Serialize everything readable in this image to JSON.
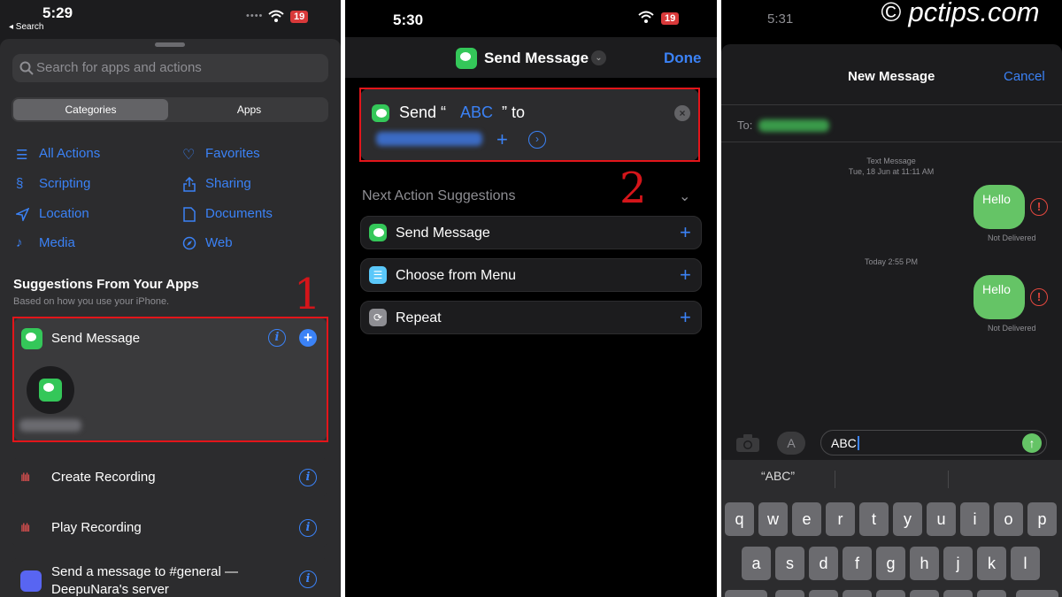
{
  "watermark": "© pctips.com",
  "panel1": {
    "status": {
      "time": "5:29",
      "back": "◂ Search",
      "battery": "19"
    },
    "search_placeholder": "Search for apps and actions",
    "segments": [
      "Categories",
      "Apps"
    ],
    "categories": [
      {
        "label": "All Actions",
        "icon": "list-icon"
      },
      {
        "label": "Favorites",
        "icon": "heart-icon"
      },
      {
        "label": "Scripting",
        "icon": "scripting-icon"
      },
      {
        "label": "Sharing",
        "icon": "share-icon"
      },
      {
        "label": "Location",
        "icon": "location-arrow-icon"
      },
      {
        "label": "Documents",
        "icon": "document-icon"
      },
      {
        "label": "Media",
        "icon": "music-note-icon"
      },
      {
        "label": "Web",
        "icon": "compass-icon"
      }
    ],
    "suggestions_title": "Suggestions From Your Apps",
    "suggestions_subtitle": "Based on how you use your iPhone.",
    "send_message": "Send Message",
    "annotation": "1",
    "rows": [
      {
        "label": "Create Recording",
        "icon": "waveform-icon"
      },
      {
        "label": "Play Recording",
        "icon": "waveform-icon"
      },
      {
        "label": "Send a message to #general —\nDeepuNara's server",
        "icon": "discord-icon"
      }
    ]
  },
  "panel2": {
    "status": {
      "time": "5:30",
      "battery": "19"
    },
    "title": "Send Message",
    "done": "Done",
    "action": {
      "send": "Send “",
      "abc": "ABC",
      "to": "” to"
    },
    "annotation": "2",
    "next_title": "Next Action Suggestions",
    "suggestions": [
      {
        "label": "Send Message",
        "icon": "messages-icon",
        "color": "#34c759"
      },
      {
        "label": "Choose from Menu",
        "icon": "menu-icon",
        "color": "#5ac8fa"
      },
      {
        "label": "Repeat",
        "icon": "repeat-icon",
        "color": "#8e8e93"
      }
    ]
  },
  "panel3": {
    "status": {
      "time": "5:31"
    },
    "title": "New Message",
    "cancel": "Cancel",
    "to_label": "To:",
    "meta1_line1": "Text Message",
    "meta1_line2": "Tue, 18 Jun at 11:11 AM",
    "bubble1": "Hello",
    "not_delivered1": "Not Delivered",
    "meta2": "Today 2:55 PM",
    "bubble2": "Hello",
    "not_delivered2": "Not Delivered",
    "input_value": "ABC",
    "predictive": [
      "“ABC”",
      "",
      ""
    ],
    "keys_row1": [
      "q",
      "w",
      "e",
      "r",
      "t",
      "y",
      "u",
      "i",
      "o",
      "p"
    ],
    "keys_row2": [
      "a",
      "s",
      "d",
      "f",
      "g",
      "h",
      "j",
      "k",
      "l"
    ]
  }
}
